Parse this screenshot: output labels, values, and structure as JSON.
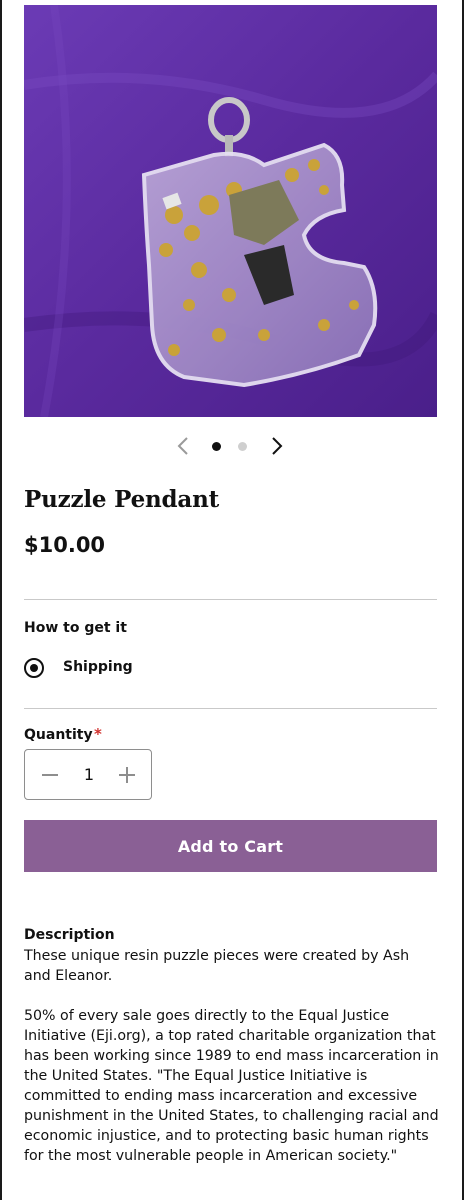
{
  "product": {
    "image_alt": "Resin puzzle piece pendant with gold and silver flakes on purple fabric",
    "title": "Puzzle Pendant",
    "price": "$10.00"
  },
  "carousel": {
    "prev_icon": "chevron-left-icon",
    "next_icon": "chevron-right-icon",
    "current_slide": 1,
    "total_slides": 2
  },
  "fulfillment": {
    "label": "How to get it",
    "selected_option": "Shipping"
  },
  "quantity": {
    "label": "Quantity",
    "required_marker": "*",
    "value": "1"
  },
  "cart": {
    "button_label": "Add to Cart"
  },
  "description": {
    "heading": "Description",
    "paragraphs": [
      "These unique resin puzzle pieces were created by Ash and Eleanor.",
      "50% of every sale goes directly to the Equal Justice Initiative (Eji.org), a top rated charitable organization that has been working since 1989 to end mass incarceration in the United States. \"The Equal Justice Initiative is committed to ending mass incarceration and excessive punishment in the United States, to challenging racial and economic injustice, and to protecting basic human rights for the most vulnerable people in American society.\""
    ]
  },
  "colors": {
    "accent_button": "#8a6095",
    "required": "#d0312d",
    "background_fabric": "#5a2a9e"
  }
}
